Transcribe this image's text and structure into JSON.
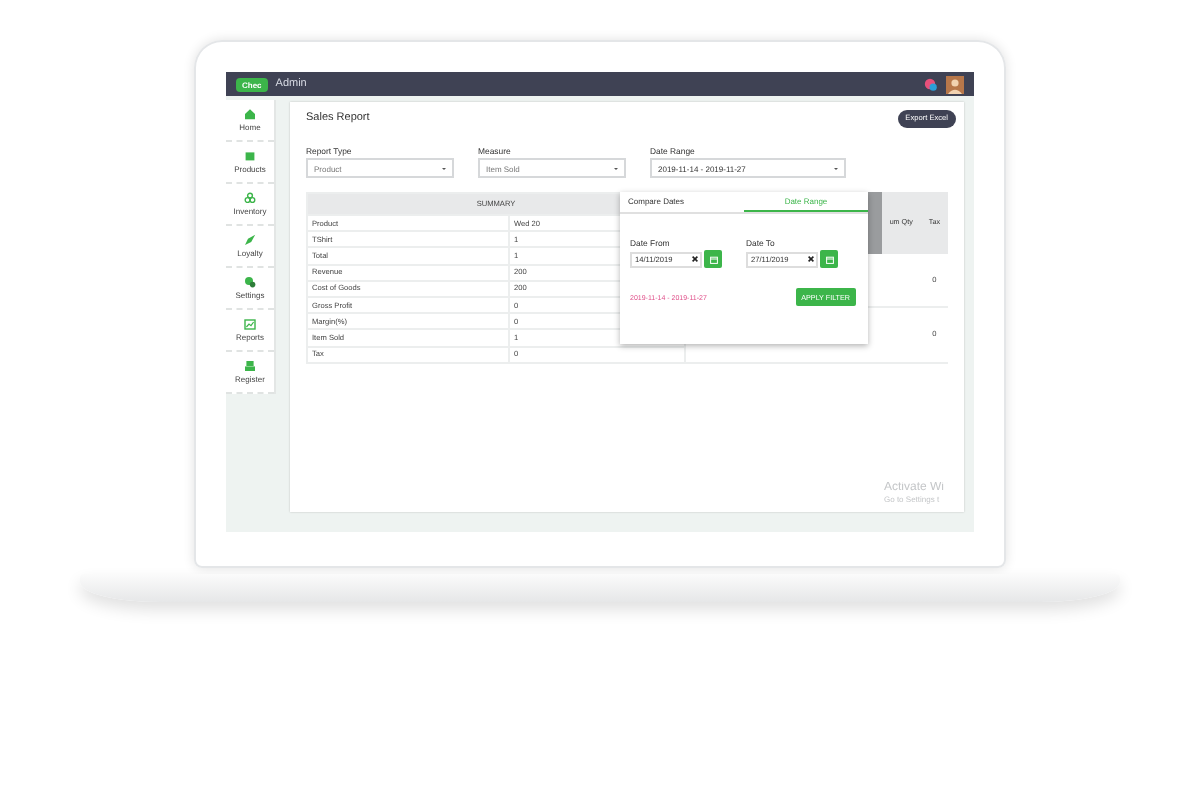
{
  "topbar": {
    "logo": "Chec",
    "title": "Admin"
  },
  "sidebar": {
    "items": [
      {
        "label": "Home"
      },
      {
        "label": "Products"
      },
      {
        "label": "Inventory"
      },
      {
        "label": "Loyalty"
      },
      {
        "label": "Settings"
      },
      {
        "label": "Reports"
      },
      {
        "label": "Register"
      }
    ]
  },
  "page": {
    "title": "Sales Report",
    "export_button": "Export Excel"
  },
  "filters": [
    {
      "label": "Report Type",
      "value": "Product"
    },
    {
      "label": "Measure",
      "value": "Item Sold"
    },
    {
      "label": "Date Range",
      "value": "2019-11-14 - 2019-11-27"
    }
  ],
  "summary": {
    "heading": "SUMMARY",
    "rows": [
      [
        "Product",
        "Wed 20"
      ],
      [
        "TShirt",
        "1"
      ],
      [
        "Total",
        "1"
      ],
      [
        "Revenue",
        "200"
      ],
      [
        "Cost of Goods",
        "200"
      ],
      [
        "Gross Profit",
        "0"
      ],
      [
        "Margin(%)",
        "0"
      ],
      [
        "Item Sold",
        "1"
      ],
      [
        "Tax",
        "0"
      ]
    ]
  },
  "detail": {
    "columns": [
      "um Qty",
      "Tax"
    ],
    "rows": [
      [
        "",
        "0"
      ],
      [
        "",
        "0"
      ]
    ]
  },
  "date_popup": {
    "tabs": [
      {
        "label": "Compare Dates",
        "selected": false
      },
      {
        "label": "Date Range",
        "selected": true
      }
    ],
    "from": {
      "label": "Date From",
      "value": "14/11/2019"
    },
    "to": {
      "label": "Date To",
      "value": "27/11/2019"
    },
    "range_text": "2019-11-14 - 2019-11-27",
    "apply_button": "APPLY FILTER"
  },
  "os_notice": [
    "Activate Wi",
    "Go to Settings t"
  ]
}
